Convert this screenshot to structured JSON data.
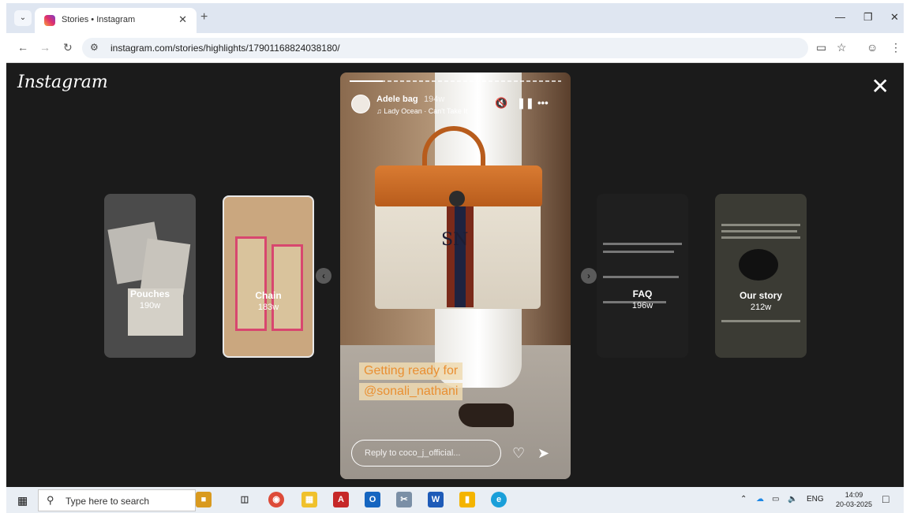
{
  "browser": {
    "tab_title": "Stories • Instagram",
    "url": "instagram.com/stories/highlights/17901168824038180/"
  },
  "viewer": {
    "logo": "Instagram",
    "highlights": [
      {
        "title": "Pouches",
        "age": "190w"
      },
      {
        "title": "Chain",
        "age": "183w"
      },
      {
        "title": "FAQ",
        "age": "196w"
      },
      {
        "title": "Our story",
        "age": "212w"
      }
    ],
    "story": {
      "account": "Adele bag",
      "age": "194w",
      "music": "Lady Ocean · Can't Take It",
      "monogram": "SN",
      "caption_line1": "Getting ready for",
      "caption_line2": "@sonali_nathani",
      "reply_placeholder": "Reply to coco_j_official..."
    }
  },
  "taskbar": {
    "search_placeholder": "Type here to search",
    "language": "ENG",
    "time": "14:09",
    "date": "20-03-2025"
  },
  "colors": {
    "viewer_bg": "#1b1b1b",
    "caption_text": "#e98f32",
    "chrome_tabbar": "#dfe6f1"
  }
}
